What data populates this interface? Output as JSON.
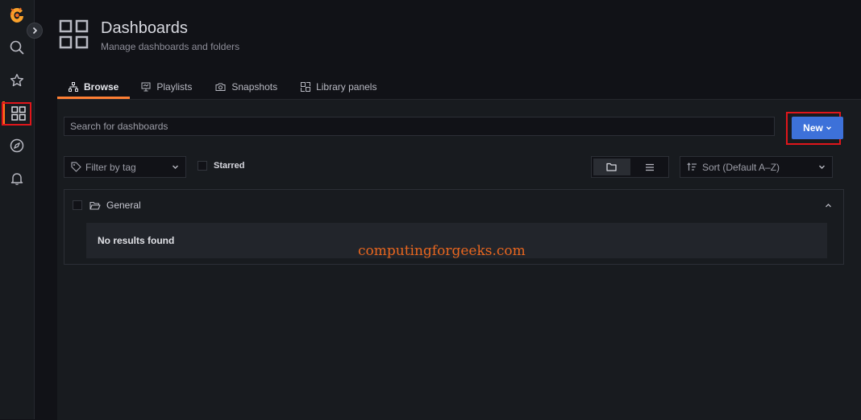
{
  "sidebar": {
    "items": [
      {
        "name": "logo",
        "icon": "grafana-logo-icon"
      },
      {
        "name": "search",
        "icon": "search-icon"
      },
      {
        "name": "starred",
        "icon": "star-icon"
      },
      {
        "name": "dashboards",
        "icon": "dashboards-grid-icon",
        "active": true
      },
      {
        "name": "explore",
        "icon": "compass-icon"
      },
      {
        "name": "alerting",
        "icon": "bell-icon"
      }
    ],
    "expand_icon": "chevron-right-icon"
  },
  "header": {
    "title": "Dashboards",
    "subtitle": "Manage dashboards and folders",
    "icon": "dashboards-grid-icon"
  },
  "tabs": [
    {
      "label": "Browse",
      "icon": "sitemap-icon",
      "active": true
    },
    {
      "label": "Playlists",
      "icon": "presentation-icon",
      "active": false
    },
    {
      "label": "Snapshots",
      "icon": "camera-icon",
      "active": false
    },
    {
      "label": "Library panels",
      "icon": "library-panels-icon",
      "active": false
    }
  ],
  "search": {
    "placeholder": "Search for dashboards",
    "value": ""
  },
  "new_button": {
    "label": "New"
  },
  "filters": {
    "tag_placeholder": "Filter by tag",
    "starred_label": "Starred",
    "sort_label": "Sort (Default A–Z)",
    "view_modes": [
      "folder-view-icon",
      "list-view-icon"
    ],
    "active_view": "folder-view-icon"
  },
  "folder": {
    "name": "General",
    "empty_message": "No results found"
  },
  "watermark": "computingforgeeks.com",
  "colors": {
    "accent": "#ff7f34",
    "primary_button": "#3d71d9",
    "highlight": "#e0161b",
    "background": "#111217",
    "panel": "#181b1f"
  }
}
